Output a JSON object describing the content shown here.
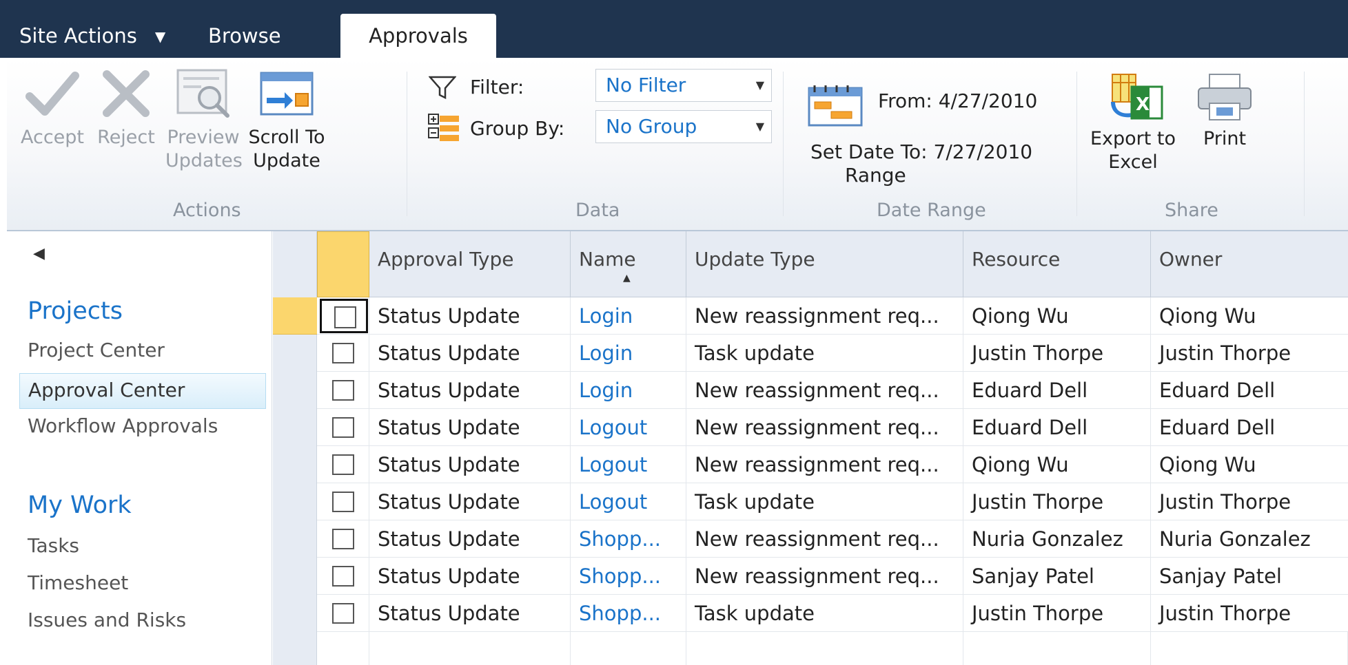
{
  "nav_tabs": {
    "site_actions": "Site Actions",
    "site_actions_caret": "▼",
    "browse": "Browse",
    "approvals": "Approvals"
  },
  "ribbon": {
    "actions": {
      "group_label": "Actions",
      "accept": "Accept",
      "reject": "Reject",
      "preview_updates": "Preview\nUpdates",
      "scroll_to_update": "Scroll To\nUpdate"
    },
    "data": {
      "group_label": "Data",
      "filter_label": "Filter:",
      "filter_value": "No Filter",
      "group_by_label": "Group By:",
      "group_by_value": "No Group"
    },
    "date_range": {
      "group_label": "Date Range",
      "from": "From: 4/27/2010",
      "to": "Set Date To: 7/27/2010",
      "range": "Range"
    },
    "share": {
      "group_label": "Share",
      "export_to_excel": "Export to\nExcel",
      "print": "Print"
    }
  },
  "left_nav": {
    "back_arrow": "◀",
    "projects_heading": "Projects",
    "project_center": "Project Center",
    "approval_center": "Approval Center",
    "workflow_approvals": "Workflow Approvals",
    "my_work_heading": "My Work",
    "tasks": "Tasks",
    "timesheet": "Timesheet",
    "issues_and_risks": "Issues and Risks"
  },
  "grid": {
    "columns": [
      "Approval Type",
      "Name",
      "Update Type",
      "Resource",
      "Owner"
    ],
    "sort_arrow": "▲",
    "rows": [
      [
        "Status Update",
        "Login",
        "New reassignment req...",
        "Qiong Wu",
        "Qiong Wu"
      ],
      [
        "Status Update",
        "Login",
        "Task update",
        "Justin Thorpe",
        "Justin Thorpe"
      ],
      [
        "Status Update",
        "Login",
        "New reassignment req...",
        "Eduard Dell",
        "Eduard Dell"
      ],
      [
        "Status Update",
        "Logout",
        "New reassignment req...",
        "Eduard Dell",
        "Eduard Dell"
      ],
      [
        "Status Update",
        "Logout",
        "New reassignment req...",
        "Qiong Wu",
        "Qiong Wu"
      ],
      [
        "Status Update",
        "Logout",
        "Task update",
        "Justin Thorpe",
        "Justin Thorpe"
      ],
      [
        "Status Update",
        "Shopp...",
        "New reassignment req...",
        "Nuria Gonzalez",
        "Nuria Gonzalez"
      ],
      [
        "Status Update",
        "Shopp...",
        "New reassignment req...",
        "Sanjay Patel",
        "Sanjay Patel"
      ],
      [
        "Status Update",
        "Shopp...",
        "Task update",
        "Justin Thorpe",
        "Justin Thorpe"
      ]
    ]
  },
  "colors": {
    "topbar": "#1f344f",
    "link": "#1a73c9",
    "selection": "#fbd66d",
    "grid_header": "#e6ebf3"
  }
}
